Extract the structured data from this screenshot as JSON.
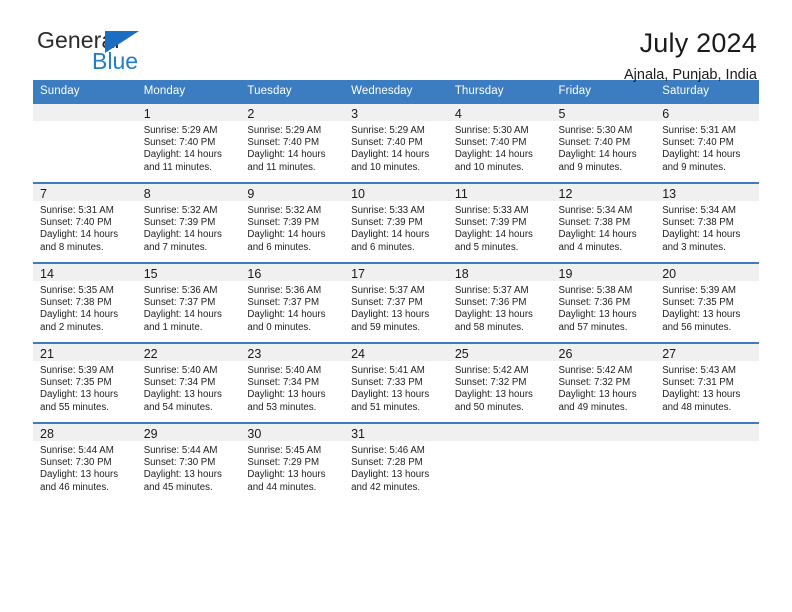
{
  "logo": {
    "line1": "General",
    "line2": "Blue",
    "mark": "triangle-flag"
  },
  "header": {
    "title": "July 2024",
    "subtitle": "Ajnala, Punjab, India"
  },
  "colors": {
    "header_blue": "#3b7dc0",
    "logo_blue": "#1f7fc4",
    "daynum_band": "#f0f0f0",
    "text": "#1a1a1a"
  },
  "weekdays": [
    "Sunday",
    "Monday",
    "Tuesday",
    "Wednesday",
    "Thursday",
    "Friday",
    "Saturday"
  ],
  "weeks": [
    [
      {
        "day": "",
        "lines": []
      },
      {
        "day": "1",
        "lines": [
          "Sunrise: 5:29 AM",
          "Sunset: 7:40 PM",
          "Daylight: 14 hours",
          "and 11 minutes."
        ]
      },
      {
        "day": "2",
        "lines": [
          "Sunrise: 5:29 AM",
          "Sunset: 7:40 PM",
          "Daylight: 14 hours",
          "and 11 minutes."
        ]
      },
      {
        "day": "3",
        "lines": [
          "Sunrise: 5:29 AM",
          "Sunset: 7:40 PM",
          "Daylight: 14 hours",
          "and 10 minutes."
        ]
      },
      {
        "day": "4",
        "lines": [
          "Sunrise: 5:30 AM",
          "Sunset: 7:40 PM",
          "Daylight: 14 hours",
          "and 10 minutes."
        ]
      },
      {
        "day": "5",
        "lines": [
          "Sunrise: 5:30 AM",
          "Sunset: 7:40 PM",
          "Daylight: 14 hours",
          "and 9 minutes."
        ]
      },
      {
        "day": "6",
        "lines": [
          "Sunrise: 5:31 AM",
          "Sunset: 7:40 PM",
          "Daylight: 14 hours",
          "and 9 minutes."
        ]
      }
    ],
    [
      {
        "day": "7",
        "lines": [
          "Sunrise: 5:31 AM",
          "Sunset: 7:40 PM",
          "Daylight: 14 hours",
          "and 8 minutes."
        ]
      },
      {
        "day": "8",
        "lines": [
          "Sunrise: 5:32 AM",
          "Sunset: 7:39 PM",
          "Daylight: 14 hours",
          "and 7 minutes."
        ]
      },
      {
        "day": "9",
        "lines": [
          "Sunrise: 5:32 AM",
          "Sunset: 7:39 PM",
          "Daylight: 14 hours",
          "and 6 minutes."
        ]
      },
      {
        "day": "10",
        "lines": [
          "Sunrise: 5:33 AM",
          "Sunset: 7:39 PM",
          "Daylight: 14 hours",
          "and 6 minutes."
        ]
      },
      {
        "day": "11",
        "lines": [
          "Sunrise: 5:33 AM",
          "Sunset: 7:39 PM",
          "Daylight: 14 hours",
          "and 5 minutes."
        ]
      },
      {
        "day": "12",
        "lines": [
          "Sunrise: 5:34 AM",
          "Sunset: 7:38 PM",
          "Daylight: 14 hours",
          "and 4 minutes."
        ]
      },
      {
        "day": "13",
        "lines": [
          "Sunrise: 5:34 AM",
          "Sunset: 7:38 PM",
          "Daylight: 14 hours",
          "and 3 minutes."
        ]
      }
    ],
    [
      {
        "day": "14",
        "lines": [
          "Sunrise: 5:35 AM",
          "Sunset: 7:38 PM",
          "Daylight: 14 hours",
          "and 2 minutes."
        ]
      },
      {
        "day": "15",
        "lines": [
          "Sunrise: 5:36 AM",
          "Sunset: 7:37 PM",
          "Daylight: 14 hours",
          "and 1 minute."
        ]
      },
      {
        "day": "16",
        "lines": [
          "Sunrise: 5:36 AM",
          "Sunset: 7:37 PM",
          "Daylight: 14 hours",
          "and 0 minutes."
        ]
      },
      {
        "day": "17",
        "lines": [
          "Sunrise: 5:37 AM",
          "Sunset: 7:37 PM",
          "Daylight: 13 hours",
          "and 59 minutes."
        ]
      },
      {
        "day": "18",
        "lines": [
          "Sunrise: 5:37 AM",
          "Sunset: 7:36 PM",
          "Daylight: 13 hours",
          "and 58 minutes."
        ]
      },
      {
        "day": "19",
        "lines": [
          "Sunrise: 5:38 AM",
          "Sunset: 7:36 PM",
          "Daylight: 13 hours",
          "and 57 minutes."
        ]
      },
      {
        "day": "20",
        "lines": [
          "Sunrise: 5:39 AM",
          "Sunset: 7:35 PM",
          "Daylight: 13 hours",
          "and 56 minutes."
        ]
      }
    ],
    [
      {
        "day": "21",
        "lines": [
          "Sunrise: 5:39 AM",
          "Sunset: 7:35 PM",
          "Daylight: 13 hours",
          "and 55 minutes."
        ]
      },
      {
        "day": "22",
        "lines": [
          "Sunrise: 5:40 AM",
          "Sunset: 7:34 PM",
          "Daylight: 13 hours",
          "and 54 minutes."
        ]
      },
      {
        "day": "23",
        "lines": [
          "Sunrise: 5:40 AM",
          "Sunset: 7:34 PM",
          "Daylight: 13 hours",
          "and 53 minutes."
        ]
      },
      {
        "day": "24",
        "lines": [
          "Sunrise: 5:41 AM",
          "Sunset: 7:33 PM",
          "Daylight: 13 hours",
          "and 51 minutes."
        ]
      },
      {
        "day": "25",
        "lines": [
          "Sunrise: 5:42 AM",
          "Sunset: 7:32 PM",
          "Daylight: 13 hours",
          "and 50 minutes."
        ]
      },
      {
        "day": "26",
        "lines": [
          "Sunrise: 5:42 AM",
          "Sunset: 7:32 PM",
          "Daylight: 13 hours",
          "and 49 minutes."
        ]
      },
      {
        "day": "27",
        "lines": [
          "Sunrise: 5:43 AM",
          "Sunset: 7:31 PM",
          "Daylight: 13 hours",
          "and 48 minutes."
        ]
      }
    ],
    [
      {
        "day": "28",
        "lines": [
          "Sunrise: 5:44 AM",
          "Sunset: 7:30 PM",
          "Daylight: 13 hours",
          "and 46 minutes."
        ]
      },
      {
        "day": "29",
        "lines": [
          "Sunrise: 5:44 AM",
          "Sunset: 7:30 PM",
          "Daylight: 13 hours",
          "and 45 minutes."
        ]
      },
      {
        "day": "30",
        "lines": [
          "Sunrise: 5:45 AM",
          "Sunset: 7:29 PM",
          "Daylight: 13 hours",
          "and 44 minutes."
        ]
      },
      {
        "day": "31",
        "lines": [
          "Sunrise: 5:46 AM",
          "Sunset: 7:28 PM",
          "Daylight: 13 hours",
          "and 42 minutes."
        ]
      },
      {
        "day": "",
        "lines": []
      },
      {
        "day": "",
        "lines": []
      },
      {
        "day": "",
        "lines": []
      }
    ]
  ]
}
